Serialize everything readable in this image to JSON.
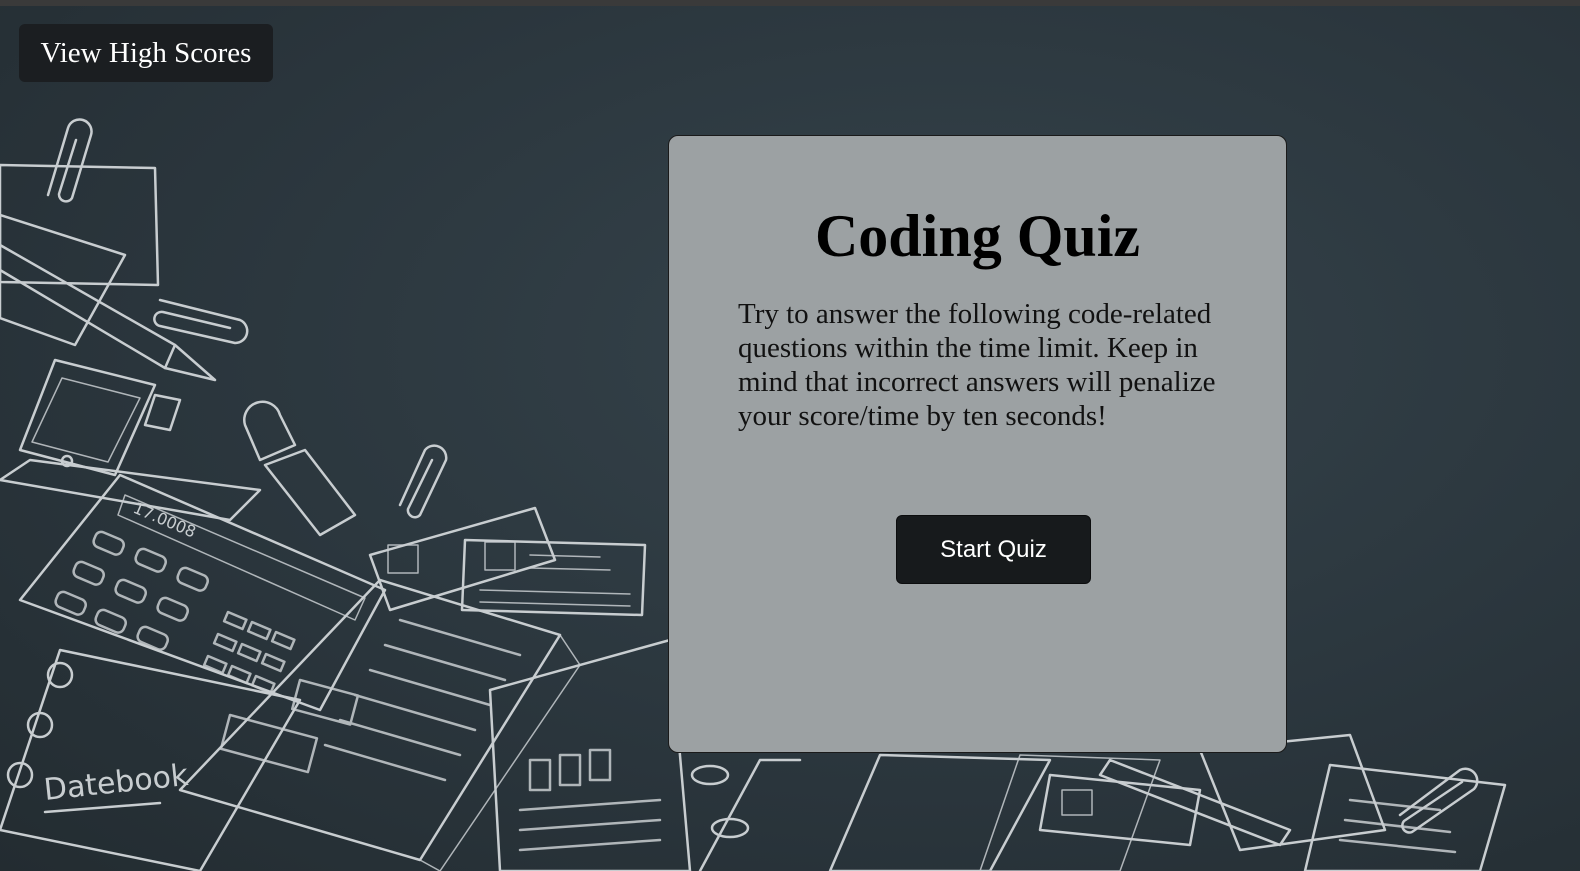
{
  "header": {
    "high_scores_label": "View High Scores"
  },
  "quiz": {
    "title": "Coding Quiz",
    "description": "Try to answer the following code-related questions within the time limit. Keep in mind that incorrect answers will penalize your score/time by ten seconds!",
    "start_label": "Start Quiz"
  },
  "background": {
    "calculator_display": "17.0008",
    "datebook_label": "Datebook"
  },
  "colors": {
    "background": "#2c373e",
    "card": "#9ca1a3",
    "button": "#171a1c",
    "button_text": "#ffffff",
    "doodle_lines": "#c8cdd0"
  },
  "icons": [
    "paperclip-icon",
    "phone-icon",
    "calculator-icon",
    "usb-drive-icon",
    "id-card-icon",
    "notebook-icon",
    "pencil-icon"
  ]
}
